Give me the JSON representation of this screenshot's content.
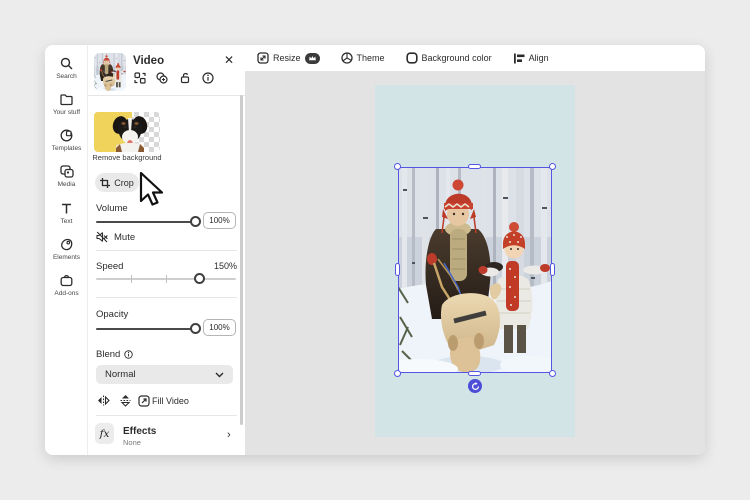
{
  "nav": {
    "items": [
      {
        "label": "Search"
      },
      {
        "label": "Your stuff"
      },
      {
        "label": "Templates"
      },
      {
        "label": "Media"
      },
      {
        "label": "Text"
      },
      {
        "label": "Elements"
      },
      {
        "label": "Add-ons"
      }
    ]
  },
  "panel": {
    "title": "Video",
    "remove_background_label": "Remove background",
    "crop_label": "Crop",
    "volume_label": "Volume",
    "volume_value": "100%",
    "mute_label": "Mute",
    "speed_label": "Speed",
    "speed_value": "150%",
    "opacity_label": "Opacity",
    "opacity_value": "100%",
    "blend_label": "Blend",
    "blend_value": "Normal",
    "fill_video_label": "Fill Video",
    "effects_label": "Effects",
    "effects_value": "None",
    "fx_glyph": "fx",
    "close_glyph": "✕",
    "chevron_right_glyph": "›"
  },
  "toolbar": {
    "resize_label": "Resize",
    "theme_label": "Theme",
    "background_color_label": "Background color",
    "align_label": "Align"
  },
  "sliders": {
    "volume_percent": 100,
    "speed_percent": 150,
    "speed_max": 200,
    "opacity_percent": 100
  },
  "colors": {
    "accent": "#5456e3",
    "artboard": "#d3e4e6",
    "premium_badge": "#3b3b3b"
  }
}
